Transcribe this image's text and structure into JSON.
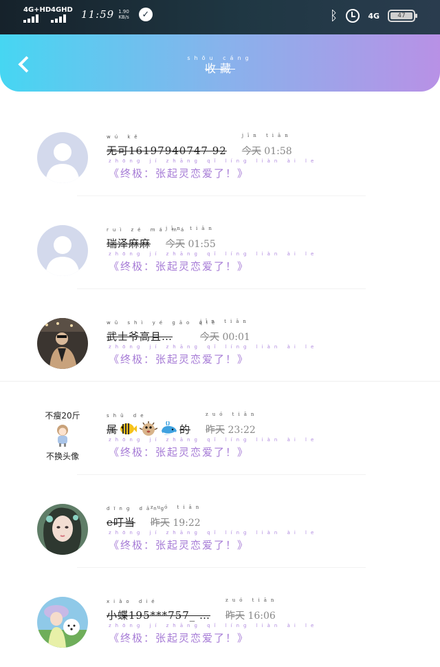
{
  "status_bar": {
    "network1": "4G+HD",
    "network2": "4GHD",
    "time": "11:59",
    "speed_value": "1.90",
    "speed_unit": "KB/s",
    "network3": "4G",
    "battery": "47"
  },
  "header": {
    "title_pinyin": "shōu cáng",
    "title": "收藏"
  },
  "favorites": [
    {
      "name_pinyin": "wú  kě",
      "name": "无可16197940747 92",
      "time_pinyin": "jīn  tiān",
      "day": "今天",
      "time": "01:58",
      "msg_pinyin": "zhōng  jí     zhāng  qǐ  líng  liàn  ài  le",
      "msg": "《终极：张起灵恋爱了！》"
    },
    {
      "name_pinyin": "ruì  zé  má  má",
      "name": "瑞泽麻麻",
      "time_pinyin": "jīn  tiān",
      "day": "今天",
      "time": "01:55",
      "msg_pinyin": "zhōng  jí     zhāng  qǐ  líng  liàn  ài  le",
      "msg": "《终极：张起灵恋爱了！》"
    },
    {
      "name_pinyin": "wǔ  shì  yé  gāo  qiè",
      "name": "武士爷高且…",
      "time_pinyin": "jīn  tiān",
      "day": "今天",
      "time": "00:01",
      "msg_pinyin": "zhōng  jí     zhāng  qǐ  líng  liàn  ài  le",
      "msg": "《终极：张起灵恋爱了！》"
    },
    {
      "name_pinyin": "shǔ                        de",
      "name": "属",
      "name_suffix": "的",
      "time_pinyin": "zuó  tiān",
      "day": "昨天",
      "time": "23:22",
      "msg_pinyin": "zhōng  jí     zhāng  qǐ  líng  liàn  ài  le",
      "msg": "《终极：张起灵恋爱了！》",
      "avatar_text_top": "不瘦20斤",
      "avatar_text_bottom": "不换头像"
    },
    {
      "name_pinyin": "dīng dāng",
      "name": "e叮当",
      "time_pinyin": "zuó  tiān",
      "day": "昨天",
      "time": "19:22",
      "msg_pinyin": "zhōng  jí     zhāng  qǐ  líng  liàn  ài  le",
      "msg": "《终极：张起灵恋爱了！》"
    },
    {
      "name_pinyin": "xiǎo  dié",
      "name": "小蝶195***757_ …",
      "time_pinyin": "zuó  tiān",
      "day": "昨天",
      "time": "16:06",
      "msg_pinyin": "zhōng  jí     zhāng  qǐ  líng  liàn  ài  le",
      "msg": "《终极：张起灵恋爱了！》"
    }
  ],
  "colors": {
    "header_start": "#46d6f2",
    "header_end": "#b891e6",
    "message_purple": "#a67bd6",
    "placeholder_avatar": "#d3d9ec"
  }
}
